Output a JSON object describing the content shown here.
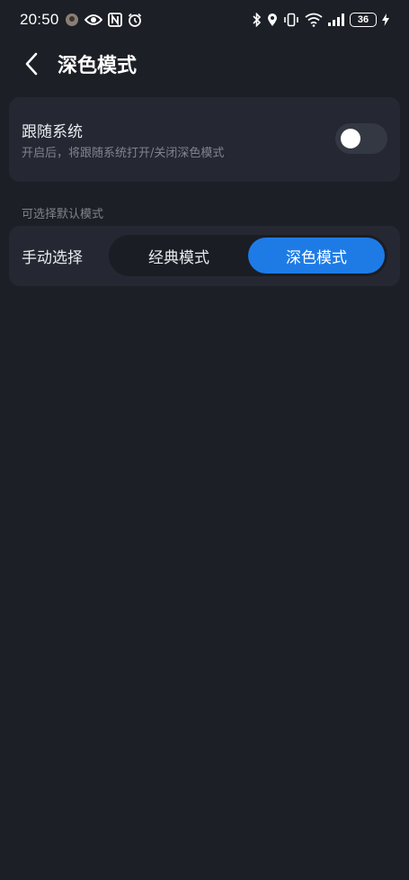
{
  "status_bar": {
    "time": "20:50",
    "battery": "36",
    "icons_left": [
      "app-notification-icon",
      "eye-icon",
      "nfc-icon",
      "alarm-icon"
    ],
    "icons_right": [
      "bluetooth-icon",
      "location-icon",
      "vibrate-icon",
      "wifi-icon",
      "signal-icon",
      "battery-icon",
      "charging-icon"
    ]
  },
  "header": {
    "title": "深色模式",
    "back_icon": "chevron-left-icon"
  },
  "follow_system": {
    "title": "跟随系统",
    "description": "开启后，将跟随系统打开/关闭深色模式",
    "enabled": false
  },
  "section_label": "可选择默认模式",
  "manual_select": {
    "label": "手动选择",
    "options": [
      "经典模式",
      "深色模式"
    ],
    "selected": "深色模式"
  },
  "colors": {
    "background": "#1c1f26",
    "card": "#252832",
    "accent": "#1e7be6",
    "secondary_text": "#7f848e"
  }
}
